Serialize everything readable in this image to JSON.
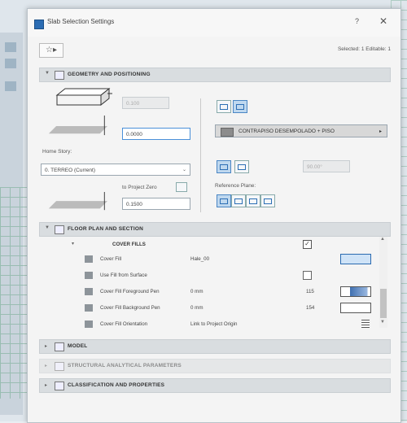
{
  "window": {
    "title": "Slab Selection Settings",
    "help": "?",
    "close": "✕"
  },
  "toolbar": {
    "favorites": "☆▸",
    "selected_info": "Selected: 1 Editable: 1"
  },
  "sections": {
    "geometry": "GEOMETRY AND POSITIONING",
    "floorplan": "FLOOR PLAN AND SECTION",
    "model": "MODEL",
    "structural": "STRUCTURAL ANALYTICAL PARAMETERS",
    "classification": "CLASSIFICATION AND PROPERTIES"
  },
  "geometry": {
    "top_offset": "0.100",
    "thickness": "0.0000",
    "home_story_label": "Home Story:",
    "home_story_value": "0. TERREO (Current)",
    "to_project_zero_label": "to Project Zero",
    "to_project_zero_value": "0.1500",
    "material": "CONTRAPISO DESEMPOLADO + PISO",
    "reference_plane_label": "Reference Plane:",
    "angle": "90.00°"
  },
  "floorplan": {
    "group_title": "COVER FILLS",
    "rows": [
      {
        "name": "Cover Fill",
        "value": "Hale_00"
      },
      {
        "name": "Use Fill from Surface",
        "value": ""
      },
      {
        "name": "Cover Fill Foreground Pen",
        "value": "0 mm",
        "num": "115"
      },
      {
        "name": "Cover Fill Background Pen",
        "value": "0 mm",
        "num": "154"
      },
      {
        "name": "Cover Fill Orientation",
        "value": "Link to Project Origin"
      }
    ]
  },
  "colors": {
    "accent": "#2b6cb3",
    "section_bg": "#d9dde0",
    "dialog_bg": "#f4f4f4"
  }
}
